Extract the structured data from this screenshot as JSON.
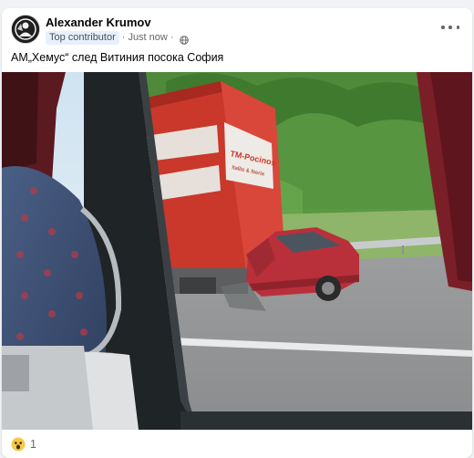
{
  "post": {
    "author": "Alexander Krumov",
    "badge": "Top contributor",
    "separator": "·",
    "time": "Just now",
    "audience_icon": "globe-icon",
    "more_icon": "more-horizontal-icon",
    "caption": "АМ„Хемус“ след Витиния посока София",
    "photo": {
      "truck_sign_top": "TM-Pocinos",
      "truck_sign_bottom": "Itallia & Iberia"
    },
    "reaction": {
      "icon": "wow-reaction-icon",
      "count": "1"
    }
  },
  "colors": {
    "page_background": "#f0f2f5",
    "card": "#ffffff",
    "badge_background": "#e7f0fd",
    "muted_text": "#65676b",
    "wow_yellow": "#f7c948"
  }
}
